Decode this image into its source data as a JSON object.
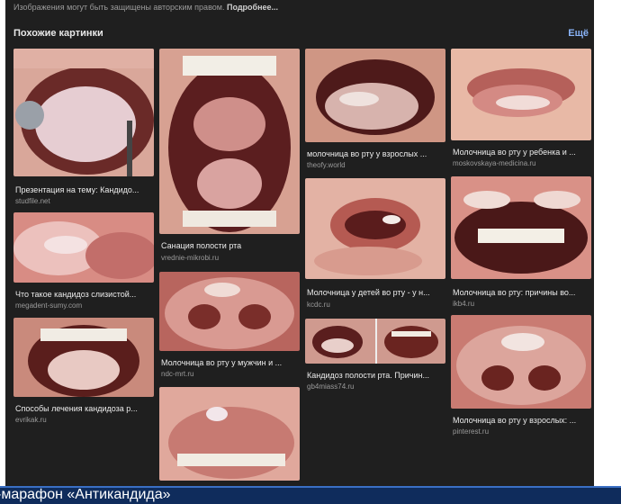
{
  "notice": {
    "text": "Изображения могут быть защищены авторским правом.",
    "link": "Подробнее..."
  },
  "section": {
    "title": "Похожие картинки",
    "more": "Ещё"
  },
  "results": [
    {
      "caption": "Презентация на тему: Кандидо...",
      "source": "studfile.net"
    },
    {
      "caption": "Что такое кандидоз слизистой...",
      "source": "megadent-sumy.com"
    },
    {
      "caption": "Способы лечения кандидоза р...",
      "source": "evrikak.ru"
    },
    {
      "caption": "Санация полости рта",
      "source": "vrednie-mikrobi.ru"
    },
    {
      "caption": "Молочница во рту у мужчин и ...",
      "source": "ndc-mrt.ru"
    },
    {
      "caption": "",
      "source": ""
    },
    {
      "caption": "молочница во рту у взрослых ...",
      "source": "theofy.world"
    },
    {
      "caption": "Молочница у детей во рту - у н...",
      "source": "kcdc.ru"
    },
    {
      "caption": "Кандидоз полости рта. Причин...",
      "source": "gb4miass74.ru"
    },
    {
      "caption": "Молочница во рту у ребенка и ...",
      "source": "moskovskaya-medicina.ru"
    },
    {
      "caption": "Молочница во рту: причины во...",
      "source": "ikb4.ru"
    },
    {
      "caption": "Молочница во рту у взрослых: ...",
      "source": "pinterest.ru"
    }
  ],
  "banner": {
    "text": "-марафон «Антикандида»"
  },
  "colors": {
    "panel": "#1f1f1f",
    "link": "#8ab4f8",
    "banner": "#0f2c5c"
  }
}
